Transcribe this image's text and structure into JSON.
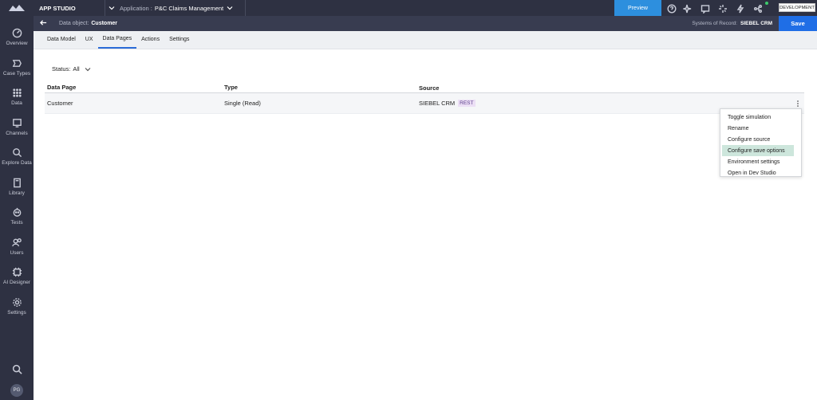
{
  "leftnav": {
    "items": [
      {
        "label": "Overview",
        "icon": "gauge-icon"
      },
      {
        "label": "Case Types",
        "icon": "case-types-icon"
      },
      {
        "label": "Data",
        "icon": "grid-icon"
      },
      {
        "label": "Channels",
        "icon": "monitor-icon"
      },
      {
        "label": "Explore Data",
        "icon": "explore-icon"
      },
      {
        "label": "Library",
        "icon": "book-icon"
      },
      {
        "label": "Tests",
        "icon": "robot-icon"
      },
      {
        "label": "Users",
        "icon": "users-icon"
      },
      {
        "label": "AI Designer",
        "icon": "ai-icon"
      },
      {
        "label": "Settings",
        "icon": "gear-icon"
      }
    ],
    "avatar": "PG"
  },
  "topbar": {
    "studio": "APP STUDIO",
    "application_label": "Application :",
    "application_value": "P&C Claims Management",
    "preview": "Preview",
    "environment": "DEVELOPMENT"
  },
  "subbar": {
    "crumb_label": "Data object:",
    "crumb_value": "Customer",
    "sor_label": "Systems of Record:",
    "sor_value": "SIEBEL CRM",
    "save": "Save"
  },
  "tabs": [
    "Data Model",
    "UX",
    "Data Pages",
    "Actions",
    "Settings"
  ],
  "active_tab": "Data Pages",
  "filter": {
    "label": "Status:",
    "value": "All"
  },
  "table": {
    "headers": [
      "Data Page",
      "Type",
      "Source"
    ],
    "rows": [
      {
        "data_page": "Customer",
        "type": "Single (Read)",
        "source": "SIEBEL CRM",
        "tag": "REST"
      }
    ]
  },
  "menu": {
    "items": [
      "Toggle simulation",
      "Rename",
      "Configure source",
      "Configure save options",
      "Environment settings",
      "Open in Dev Studio"
    ],
    "highlighted": "Configure save options"
  },
  "colors": {
    "nav_bg": "#2e3142",
    "preview": "#2d8fde",
    "save": "#1f6ee6",
    "tab_active": "#2c6cd8",
    "highlight": "#cde6dc"
  }
}
